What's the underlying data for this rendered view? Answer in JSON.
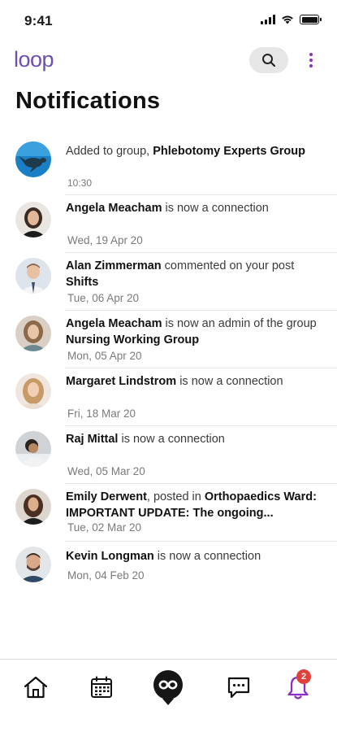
{
  "status_bar": {
    "time": "9:41"
  },
  "header": {
    "logo_text": "loop",
    "title": "Notifications"
  },
  "colors": {
    "accent": "#8a2fc4",
    "badge": "#e0413a",
    "search_bg": "#e6e6e6"
  },
  "notifications": [
    {
      "prefix": "Added to group, ",
      "name": "Phlebotomy Experts Group",
      "time": "10:30",
      "avatar_icon": "turtle-group-avatar"
    },
    {
      "name": "Angela Meacham",
      "action": " is now a connection",
      "time": "Wed, 19 Apr 20",
      "avatar_icon": "person-avatar"
    },
    {
      "name": "Alan Zimmerman",
      "action": " commented on your post ",
      "target": "Shifts",
      "time": "Tue, 06 Apr 20",
      "avatar_icon": "person-avatar"
    },
    {
      "name": "Angela Meacham",
      "action": " is now an admin of the group ",
      "target": "Nursing Working Group",
      "time": "Mon, 05 Apr 20",
      "avatar_icon": "person-avatar"
    },
    {
      "name": "Margaret Lindstrom",
      "action": " is now a connection",
      "time": "Fri, 18 Mar 20",
      "avatar_icon": "person-avatar"
    },
    {
      "name": "Raj Mittal",
      "action": " is now a connection",
      "time": "Wed, 05 Mar 20",
      "avatar_icon": "person-avatar"
    },
    {
      "name": "Emily Derwent",
      "action": ", posted in ",
      "target": "Orthopaedics Ward: IMPORTANT UPDATE: The ongoing...",
      "time": "Tue, 02 Mar 20",
      "avatar_icon": "person-avatar"
    },
    {
      "name": "Kevin Longman",
      "action": " is now a connection",
      "time": "Mon, 04 Feb 20",
      "avatar_icon": "person-avatar"
    }
  ],
  "tab_bar": {
    "items": [
      {
        "icon": "home-icon"
      },
      {
        "icon": "calendar-icon"
      },
      {
        "icon": "loop-icon"
      },
      {
        "icon": "chat-icon"
      },
      {
        "icon": "bell-icon",
        "badge": "2"
      }
    ]
  }
}
